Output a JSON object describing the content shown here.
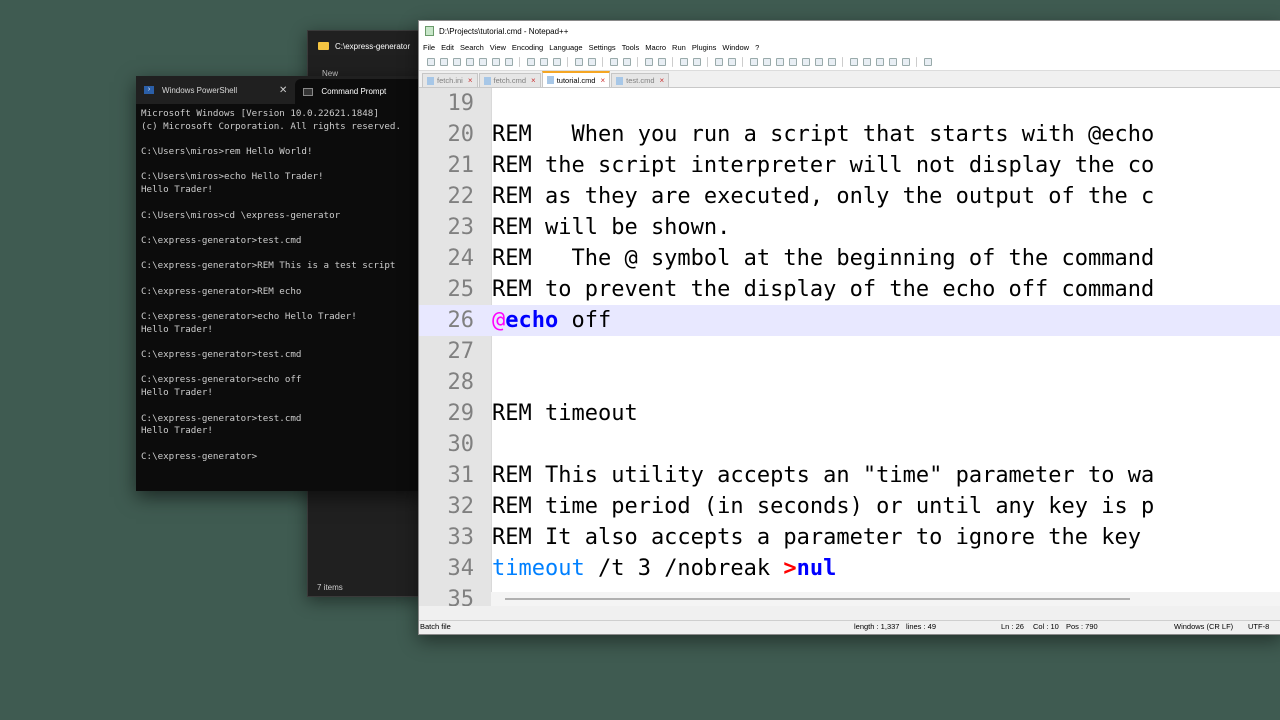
{
  "explorer": {
    "title": "C:\\express-generator",
    "new_label": "New",
    "status": "7 items"
  },
  "terminal": {
    "tabs": [
      {
        "label": "Windows PowerShell",
        "close": "✕"
      },
      {
        "label": "Command Prompt"
      }
    ],
    "lines": [
      "Microsoft Windows [Version 10.0.22621.1848]",
      "(c) Microsoft Corporation. All rights reserved.",
      "",
      "C:\\Users\\miros>rem Hello World!",
      "",
      "C:\\Users\\miros>echo Hello Trader!",
      "Hello Trader!",
      "",
      "C:\\Users\\miros>cd \\express-generator",
      "",
      "C:\\express-generator>test.cmd",
      "",
      "C:\\express-generator>REM This is a test script",
      "",
      "C:\\express-generator>REM echo",
      "",
      "C:\\express-generator>echo Hello Trader!",
      "Hello Trader!",
      "",
      "C:\\express-generator>test.cmd",
      "",
      "C:\\express-generator>echo off",
      "Hello Trader!",
      "",
      "C:\\express-generator>test.cmd",
      "Hello Trader!",
      "",
      "C:\\express-generator>"
    ]
  },
  "npp": {
    "title": "D:\\Projects\\tutorial.cmd - Notepad++",
    "menu": [
      "File",
      "Edit",
      "Search",
      "View",
      "Encoding",
      "Language",
      "Settings",
      "Tools",
      "Macro",
      "Run",
      "Plugins",
      "Window",
      "?"
    ],
    "tabs": [
      {
        "label": "fetch.ini"
      },
      {
        "label": "fetch.cmd"
      },
      {
        "label": "tutorial.cmd",
        "active": true
      },
      {
        "label": "test.cmd"
      }
    ],
    "lines": {
      "n19": "19",
      "n20": "20",
      "n21": "21",
      "n22": "22",
      "n23": "23",
      "n24": "24",
      "n25": "25",
      "n26": "26",
      "n27": "27",
      "n28": "28",
      "n29": "29",
      "n30": "30",
      "n31": "31",
      "n32": "32",
      "n33": "33",
      "n34": "34",
      "n35": "35",
      "l20": "REM   When you run a script that starts with @echo",
      "l21": "REM the script interpreter will not display the co",
      "l22": "REM as they are executed, only the output of the c",
      "l23": "REM will be shown.",
      "l24": "REM   The @ symbol at the beginning of the command",
      "l25": "REM to prevent the display of the echo off command",
      "l26_at": "@",
      "l26_kw": "echo",
      "l26_rest": " off",
      "l29": "REM timeout",
      "l31": "REM This utility accepts an \"time\" parameter to wa",
      "l32": "REM time period (in seconds) or until any key is p",
      "l33": "REM It also accepts a parameter to ignore the key",
      "l34_cmd": "timeout",
      "l34_args": " /t 3 /nobreak ",
      "l34_op": ">",
      "l34_nul": "nul"
    },
    "status": {
      "type": "Batch file",
      "length": "length : 1,337",
      "lines": "lines : 49",
      "ln": "Ln : 26",
      "col": "Col : 10",
      "pos": "Pos : 790",
      "eol": "Windows (CR LF)",
      "encoding": "UTF-8"
    }
  }
}
